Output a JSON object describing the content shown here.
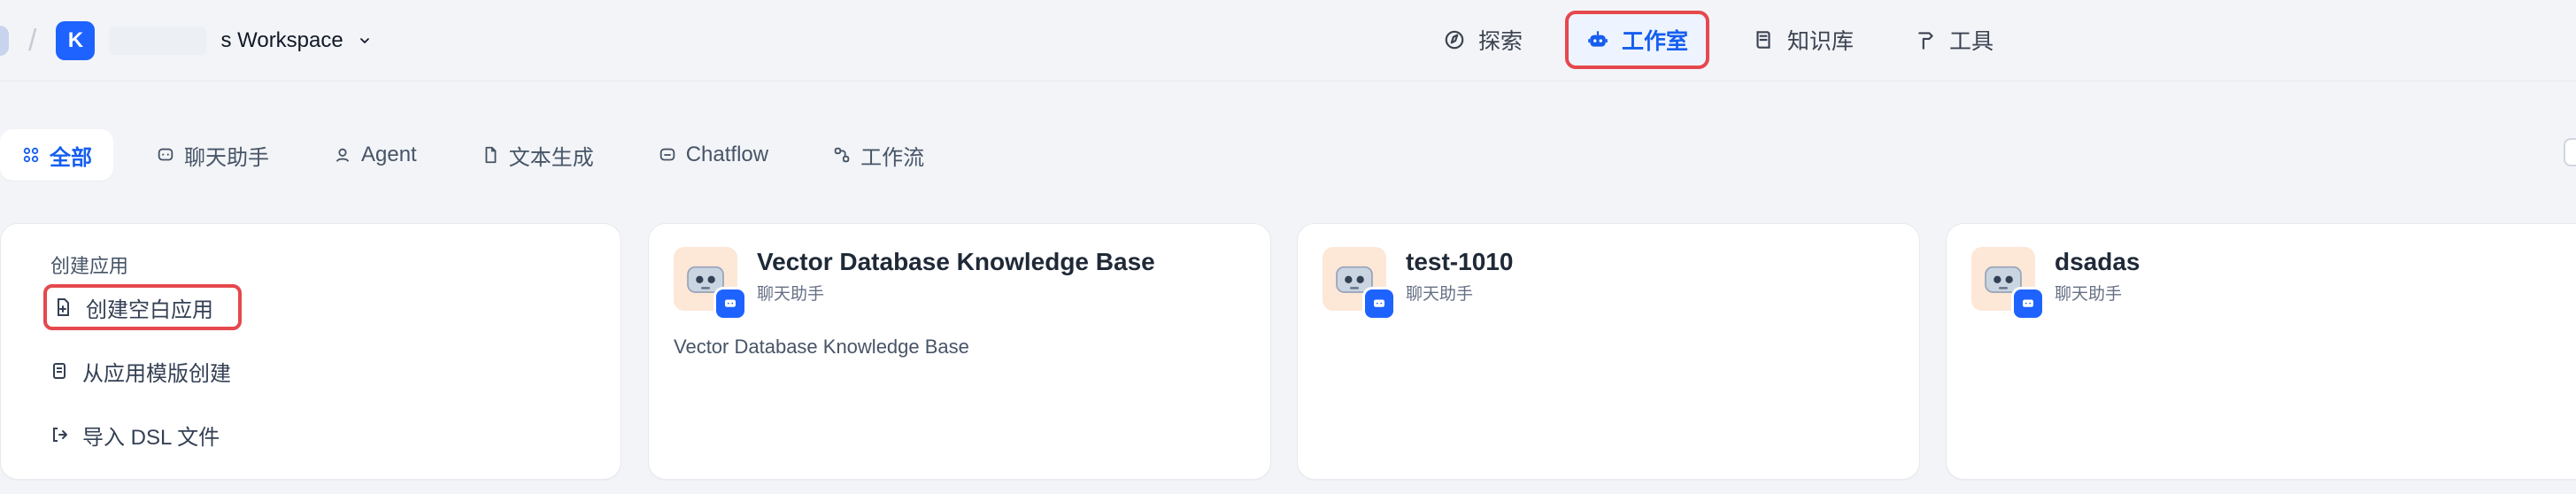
{
  "header": {
    "workspace_badge": "K",
    "workspace_name": "s Workspace",
    "nav": [
      {
        "label": "探索",
        "icon": "compass-icon"
      },
      {
        "label": "工作室",
        "icon": "robot-icon"
      },
      {
        "label": "知识库",
        "icon": "book-icon"
      },
      {
        "label": "工具",
        "icon": "hammer-icon"
      }
    ]
  },
  "filters": {
    "items": [
      {
        "label": "全部",
        "icon": "grid-icon"
      },
      {
        "label": "聊天助手",
        "icon": "chat-icon"
      },
      {
        "label": "Agent",
        "icon": "agent-icon"
      },
      {
        "label": "文本生成",
        "icon": "doc-icon"
      },
      {
        "label": "Chatflow",
        "icon": "chatflow-icon"
      },
      {
        "label": "工作流",
        "icon": "workflow-icon"
      }
    ]
  },
  "create_card": {
    "title": "创建应用",
    "items": [
      {
        "label": "创建空白应用",
        "icon": "new-file-icon"
      },
      {
        "label": "从应用模版创建",
        "icon": "template-icon"
      },
      {
        "label": "导入 DSL 文件",
        "icon": "import-icon"
      }
    ]
  },
  "apps": [
    {
      "title": "Vector Database Knowledge Base",
      "type": "聊天助手",
      "description": "Vector Database Knowledge Base"
    },
    {
      "title": "test-1010",
      "type": "聊天助手",
      "description": ""
    },
    {
      "title": "dsadas",
      "type": "聊天助手",
      "description": ""
    }
  ],
  "colors": {
    "accent": "#155EEF",
    "highlight": "#E5484D"
  }
}
